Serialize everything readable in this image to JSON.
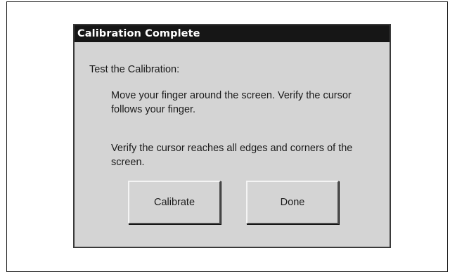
{
  "dialog": {
    "title": "Calibration Complete",
    "intro": "Test the Calibration:",
    "instruction_1": "Move your finger around the screen. Verify the cursor follows your finger.",
    "instruction_2": "Verify the cursor reaches all edges and corners of the screen."
  },
  "buttons": {
    "calibrate_label": "Calibrate",
    "done_label": "Done"
  },
  "colors": {
    "titlebar_bg": "#161616",
    "titlebar_text": "#ffffff",
    "dialog_bg": "#d4d4d4"
  }
}
